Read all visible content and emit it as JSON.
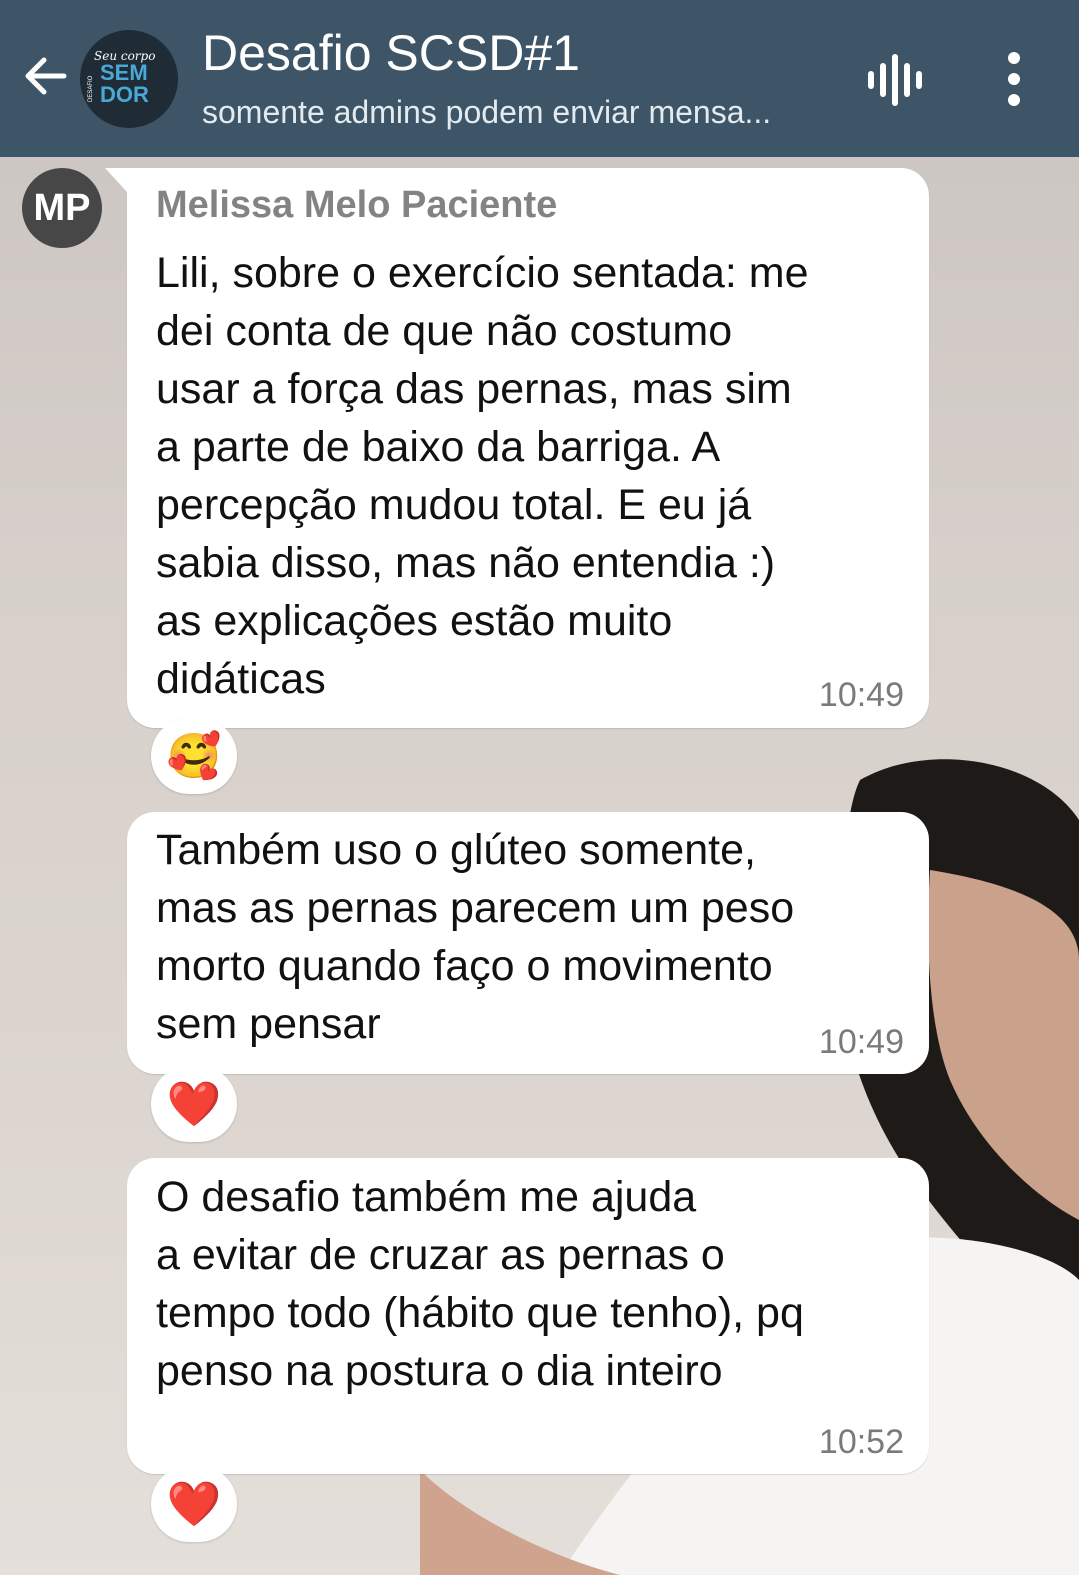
{
  "header": {
    "title": "Desafio SCSD#1",
    "subtitle": "somente admins podem enviar mensa...",
    "group_avatar_text": [
      "Seu corpo",
      "SEM",
      "DOR",
      "DESAFIO"
    ],
    "icons": [
      "back-arrow-icon",
      "voice-chat-icon",
      "more-options-icon"
    ]
  },
  "messages": [
    {
      "sender": "Melissa Melo Paciente",
      "avatar_initials": "MP",
      "text": "Lili, sobre o exercício sentada: me\ndei conta de que não costumo\nusar a força das pernas, mas sim\na parte de baixo da barriga. A\npercepção mudou total. E eu já\nsabia disso, mas não entendia :)\nas explicações estão muito\ndidáticas",
      "time": "10:49",
      "reaction": "🥰"
    },
    {
      "text": "Também uso o glúteo somente,\nmas as pernas parecem um peso\nmorto quando faço o movimento\nsem pensar",
      "time": "10:49",
      "reaction": "❤️"
    },
    {
      "text": "O desafio também me ajuda\na evitar de cruzar as pernas o\ntempo todo (hábito que tenho), pq\npenso na postura o dia inteiro",
      "time": "10:52",
      "reaction": "❤️"
    }
  ],
  "colors": {
    "header_bg": "#3d5566",
    "bubble_bg": "#ffffff",
    "sender_name": "#838383",
    "reaction_heart": "#e0192e"
  }
}
